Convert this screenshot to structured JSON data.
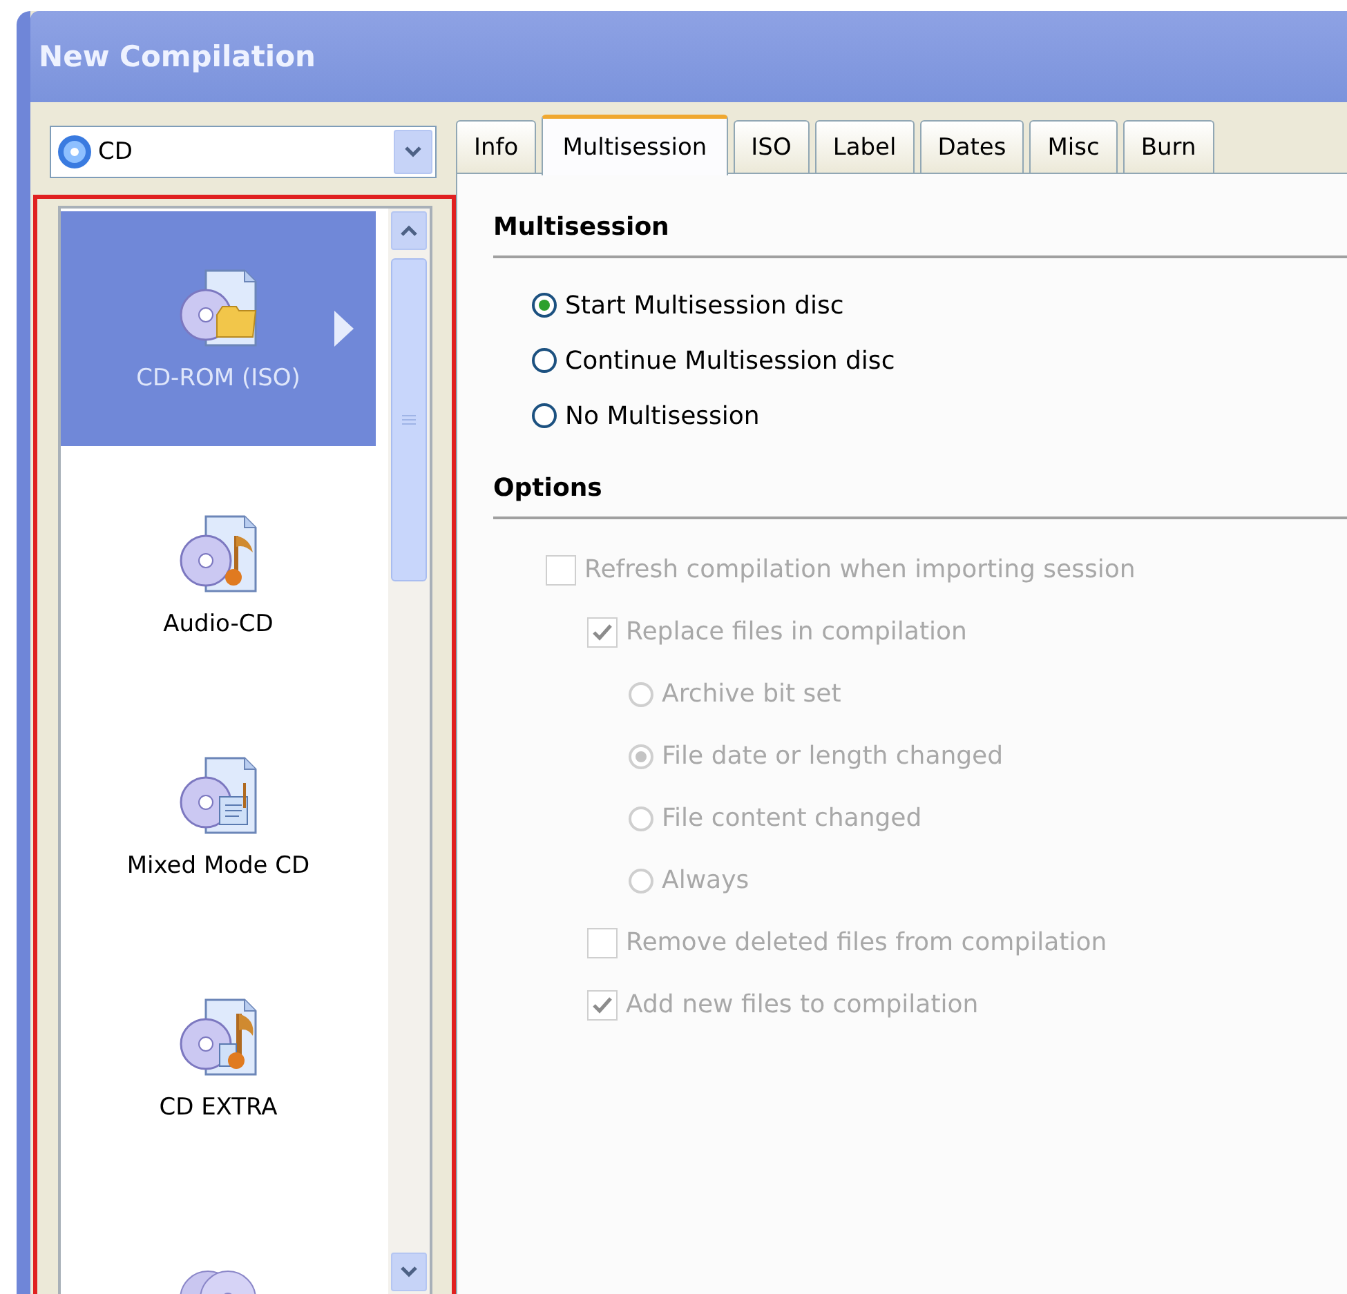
{
  "window": {
    "title": "New Compilation"
  },
  "disc_type": {
    "value": "CD"
  },
  "compilation_types": [
    {
      "label": "CD-ROM (ISO)",
      "kind": "data",
      "selected": true
    },
    {
      "label": "Audio-CD",
      "kind": "audio",
      "selected": false
    },
    {
      "label": "Mixed Mode CD",
      "kind": "mixed",
      "selected": false
    },
    {
      "label": "CD EXTRA",
      "kind": "extra",
      "selected": false
    },
    {
      "kind": "copy",
      "selected": false
    }
  ],
  "tabs": [
    {
      "label": "Info",
      "selected": false
    },
    {
      "label": "Multisession",
      "selected": true
    },
    {
      "label": "ISO",
      "selected": false
    },
    {
      "label": "Label",
      "selected": false
    },
    {
      "label": "Dates",
      "selected": false
    },
    {
      "label": "Misc",
      "selected": false
    },
    {
      "label": "Burn",
      "selected": false
    }
  ],
  "multisession": {
    "heading": "Multisession",
    "options": [
      {
        "label": "Start Multisession disc",
        "selected": true
      },
      {
        "label": "Continue Multisession disc",
        "selected": false
      },
      {
        "label": "No Multisession",
        "selected": false
      }
    ]
  },
  "options": {
    "heading": "Options",
    "items": [
      {
        "kind": "checkbox",
        "label": "Refresh compilation when importing session",
        "checked": false,
        "disabled": true,
        "children": [
          {
            "kind": "checkbox",
            "label": "Replace files in compilation",
            "checked": true,
            "disabled": true,
            "children": [
              {
                "kind": "radio",
                "label": "Archive bit set",
                "selected": false,
                "disabled": true
              },
              {
                "kind": "radio",
                "label": "File date or length changed",
                "selected": true,
                "disabled": true
              },
              {
                "kind": "radio",
                "label": "File content changed",
                "selected": false,
                "disabled": true
              },
              {
                "kind": "radio",
                "label": "Always",
                "selected": false,
                "disabled": true
              }
            ]
          },
          {
            "kind": "checkbox",
            "label": "Remove deleted files from compilation",
            "checked": false,
            "disabled": true
          },
          {
            "kind": "checkbox",
            "label": "Add new files to compilation",
            "checked": true,
            "disabled": true
          }
        ]
      }
    ]
  }
}
